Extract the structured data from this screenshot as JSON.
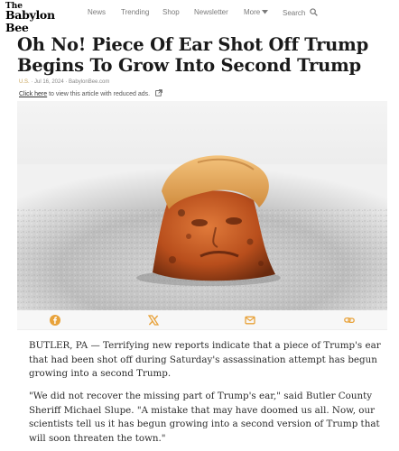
{
  "header": {
    "logo_line1": "The",
    "logo_line2": "Babylon Bee",
    "nav": [
      "News",
      "Trending",
      "Shop",
      "Newsletter",
      "More",
      "Search"
    ]
  },
  "article": {
    "title": "Oh No! Piece Of Ear Shot Off Trump Begins To Grow Into Second Trump",
    "category": "U.S.",
    "meta_rest": " · Jul 16, 2024 · BabylonBee.com",
    "reduced_ads_link": "Click here",
    "reduced_ads_text": " to view this article with reduced ads.",
    "paragraphs": [
      "BUTLER, PA — Terrifying new reports indicate that a piece of Trump's ear that had been shot off during Saturday's assassination attempt has begun growing into a second Trump.",
      "\"We did not recover the missing part of Trump's ear,\" said Butler County Sheriff Michael Slupe. \"A mistake that may have doomed us all. Now, our scientists tell us it has begun growing into a second version of Trump that will soon threaten the town.\""
    ]
  },
  "share": {
    "icons": [
      "facebook-icon",
      "x-icon",
      "email-icon",
      "copy-link-icon"
    ],
    "accent": "#e8a23a"
  },
  "colors": {
    "category": "#c8a35a",
    "nav_text": "#7a7a7a",
    "title": "#1a1a1a"
  }
}
